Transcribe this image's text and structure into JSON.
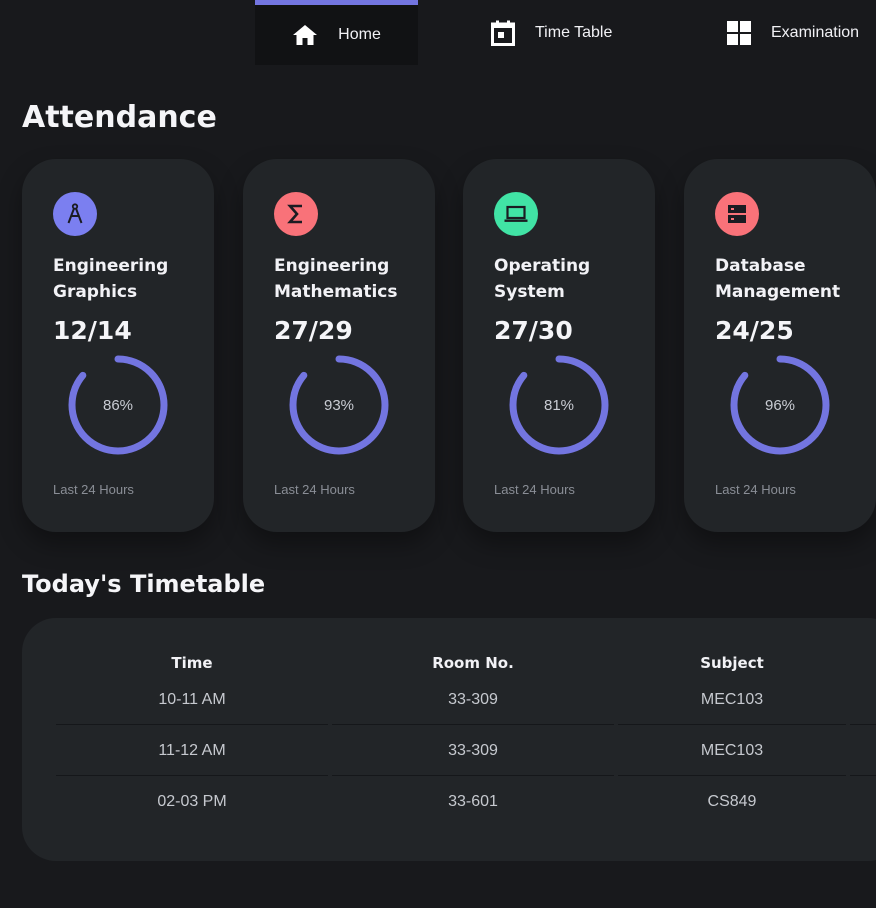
{
  "nav": {
    "tabs": [
      {
        "label": "Home",
        "icon": "home-icon"
      },
      {
        "label": "Time Table",
        "icon": "calendar-icon"
      },
      {
        "label": "Examination",
        "icon": "grid-icon"
      }
    ],
    "accent": "#7375e0"
  },
  "attendance": {
    "title": "Attendance",
    "ring_color": "#7375e0",
    "cards": [
      {
        "icon": "compass-icon",
        "badge_color": "#7b7ff0",
        "subject": "Engineering Graphics",
        "attended": "12/14",
        "percent": "86%",
        "period": "Last 24 Hours"
      },
      {
        "icon": "sigma-icon",
        "badge_color": "#f97279",
        "subject": "Engineering Mathematics",
        "attended": "27/29",
        "percent": "93%",
        "period": "Last 24 Hours"
      },
      {
        "icon": "laptop-icon",
        "badge_color": "#41e3a5",
        "subject": "Operating System",
        "attended": "27/30",
        "percent": "81%",
        "period": "Last 24 Hours"
      },
      {
        "icon": "server-icon",
        "badge_color": "#f97279",
        "subject": "Database Management",
        "attended": "24/25",
        "percent": "96%",
        "period": "Last 24 Hours"
      }
    ]
  },
  "timetable": {
    "title": "Today's Timetable",
    "columns": [
      "Time",
      "Room No.",
      "Subject"
    ],
    "rows": [
      [
        "10-11 AM",
        "33-309",
        "MEC103"
      ],
      [
        "11-12 AM",
        "33-309",
        "MEC103"
      ],
      [
        "02-03 PM",
        "33-601",
        "CS849"
      ]
    ]
  }
}
